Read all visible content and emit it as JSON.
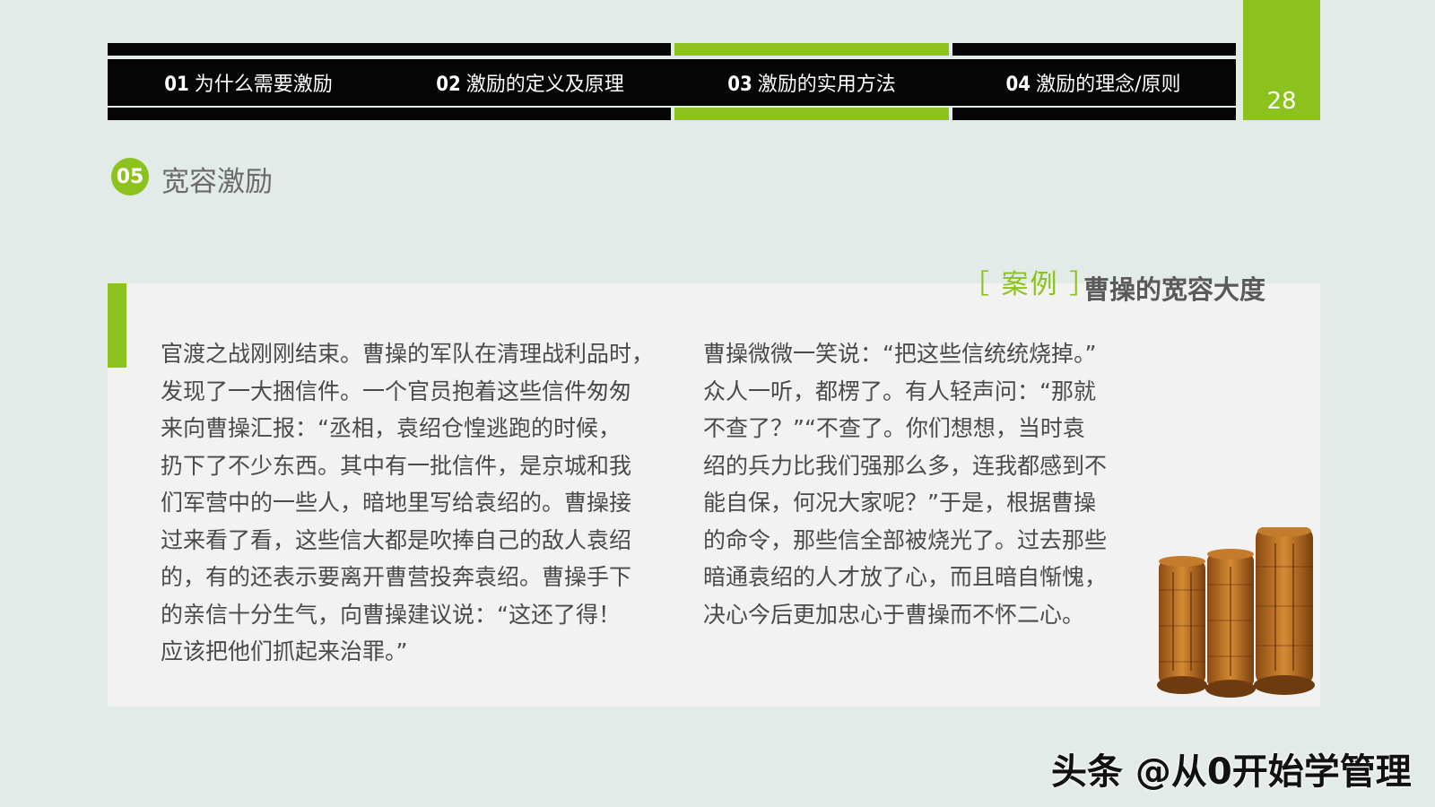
{
  "nav": {
    "tabs": [
      {
        "num": "01",
        "label": "为什么需要激励"
      },
      {
        "num": "02",
        "label": "激励的定义及原理"
      },
      {
        "num": "03",
        "label": "激励的实用方法"
      },
      {
        "num": "04",
        "label": "激励的理念/原则"
      }
    ],
    "active_index": 2,
    "page_number": "28"
  },
  "section": {
    "badge": "05",
    "title": "宽容激励"
  },
  "case": {
    "tag": "［ 案例 ］",
    "title": "曹操的宽容大度"
  },
  "story": {
    "left_lines": [
      "官渡之战刚刚结束。曹操的军队在清理战利品时，",
      "发现了一大捆信件。一个官员抱着这些信件匆匆",
      "来向曹操汇报：“丞相，袁绍仓惶逃跑的时候，",
      "扔下了不少东西。其中有一批信件，是京城和我",
      "们军营中的一些人，暗地里写给袁绍的。曹操接",
      "过来看了看，这些信大都是吹捧自己的敌人袁绍",
      "的，有的还表示要离开曹营投奔袁绍。曹操手下",
      "的亲信十分生气，向曹操建议说：“这还了得！",
      "应该把他们抓起来治罪。”"
    ],
    "right_lines": [
      "曹操微微一笑说：“把这些信统统烧掉。”",
      "众人一听，都楞了。有人轻声问：“那就",
      "不查了？”“不查了。你们想想，当时袁",
      "绍的兵力比我们强那么多，连我都感到不",
      "能自保，何况大家呢？”于是，根据曹操",
      "的命令，那些信全部被烧光了。过去那些",
      "暗通袁绍的人才放了心，而且暗自惭愧，",
      "决心今后更加忠心于曹操而不怀二心。"
    ]
  },
  "image": {
    "icon": "bamboo-scrolls-icon"
  },
  "watermark": "头条 @从0开始学管理",
  "colors": {
    "accent": "#8cc21e",
    "bar": "#050505",
    "panel": "#f2f2f2",
    "background": "#e3ebe8"
  }
}
